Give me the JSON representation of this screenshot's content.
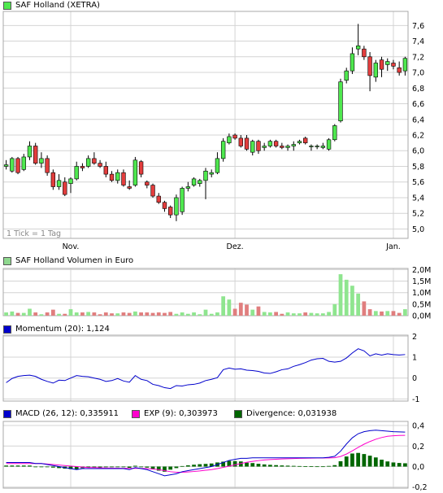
{
  "chart_data": [
    {
      "type": "candlestick",
      "title": "SAF Holland (XETRA)",
      "note": "1 Tick = 1 Tag",
      "colors": {
        "up": "#4fe84f",
        "down": "#e33d3d",
        "grid": "#d4d4d4",
        "wick": "#000000"
      },
      "x_labels": [
        {
          "label": "Nov.",
          "index": 11
        },
        {
          "label": "Dez.",
          "index": 39
        },
        {
          "label": "Jan.",
          "index": 66
        }
      ],
      "ylim": [
        4.88,
        7.78
      ],
      "y_ticks": [
        {
          "v": 5.0,
          "label": "5,0"
        },
        {
          "v": 5.2,
          "label": "5,2"
        },
        {
          "v": 5.4,
          "label": "5,4"
        },
        {
          "v": 5.6,
          "label": "5,6"
        },
        {
          "v": 5.8,
          "label": "5,8"
        },
        {
          "v": 6.0,
          "label": "6,0"
        },
        {
          "v": 6.2,
          "label": "6,2"
        },
        {
          "v": 6.4,
          "label": "6,4"
        },
        {
          "v": 6.6,
          "label": "6,6"
        },
        {
          "v": 6.8,
          "label": "6,8"
        },
        {
          "v": 7.0,
          "label": "7,0"
        },
        {
          "v": 7.2,
          "label": "7,2"
        },
        {
          "v": 7.4,
          "label": "7,4"
        },
        {
          "v": 7.6,
          "label": "7,6"
        }
      ],
      "ohlc": [
        [
          5.8,
          5.88,
          5.76,
          5.82
        ],
        [
          5.74,
          5.92,
          5.72,
          5.9
        ],
        [
          5.9,
          5.92,
          5.7,
          5.72
        ],
        [
          5.76,
          5.96,
          5.74,
          5.92
        ],
        [
          5.92,
          6.12,
          5.88,
          6.06
        ],
        [
          6.06,
          6.1,
          5.82,
          5.84
        ],
        [
          5.84,
          5.98,
          5.78,
          5.9
        ],
        [
          5.9,
          5.94,
          5.68,
          5.72
        ],
        [
          5.72,
          5.76,
          5.5,
          5.54
        ],
        [
          5.54,
          5.7,
          5.5,
          5.62
        ],
        [
          5.6,
          5.66,
          5.42,
          5.44
        ],
        [
          5.58,
          5.66,
          5.46,
          5.64
        ],
        [
          5.64,
          5.86,
          5.62,
          5.8
        ],
        [
          5.8,
          5.84,
          5.74,
          5.78
        ],
        [
          5.8,
          5.94,
          5.78,
          5.9
        ],
        [
          5.9,
          5.98,
          5.82,
          5.84
        ],
        [
          5.84,
          5.88,
          5.78,
          5.8
        ],
        [
          5.8,
          5.86,
          5.66,
          5.7
        ],
        [
          5.7,
          5.74,
          5.6,
          5.62
        ],
        [
          5.62,
          5.76,
          5.58,
          5.72
        ],
        [
          5.72,
          5.76,
          5.54,
          5.56
        ],
        [
          5.54,
          5.62,
          5.5,
          5.52
        ],
        [
          5.56,
          5.92,
          5.54,
          5.88
        ],
        [
          5.86,
          5.88,
          5.66,
          5.7
        ],
        [
          5.6,
          5.62,
          5.52,
          5.56
        ],
        [
          5.56,
          5.58,
          5.4,
          5.42
        ],
        [
          5.42,
          5.46,
          5.32,
          5.34
        ],
        [
          5.34,
          5.36,
          5.22,
          5.26
        ],
        [
          5.28,
          5.3,
          5.14,
          5.18
        ],
        [
          5.18,
          5.44,
          5.1,
          5.4
        ],
        [
          5.22,
          5.54,
          5.18,
          5.52
        ],
        [
          5.52,
          5.6,
          5.48,
          5.54
        ],
        [
          5.56,
          5.66,
          5.54,
          5.64
        ],
        [
          5.58,
          5.64,
          5.54,
          5.62
        ],
        [
          5.62,
          5.78,
          5.38,
          5.74
        ],
        [
          5.7,
          5.76,
          5.66,
          5.72
        ],
        [
          5.72,
          5.98,
          5.7,
          5.9
        ],
        [
          5.9,
          6.16,
          5.86,
          6.12
        ],
        [
          6.1,
          6.22,
          6.08,
          6.18
        ],
        [
          6.2,
          6.22,
          6.14,
          6.16
        ],
        [
          6.16,
          6.2,
          6.04,
          6.06
        ],
        [
          6.16,
          6.2,
          6.0,
          6.02
        ],
        [
          5.98,
          6.14,
          5.94,
          6.12
        ],
        [
          6.12,
          6.14,
          5.96,
          6.0
        ],
        [
          6.04,
          6.1,
          6.0,
          6.06
        ],
        [
          6.06,
          6.14,
          6.04,
          6.12
        ],
        [
          6.12,
          6.14,
          6.04,
          6.06
        ],
        [
          6.06,
          6.1,
          6.02,
          6.04
        ],
        [
          6.04,
          6.08,
          6.0,
          6.06
        ],
        [
          6.06,
          6.12,
          6.0,
          6.08
        ],
        [
          6.1,
          6.14,
          6.08,
          6.12
        ],
        [
          6.16,
          6.18,
          6.08,
          6.1
        ],
        [
          6.06,
          6.08,
          6.0,
          6.06
        ],
        [
          6.06,
          6.08,
          6.02,
          6.06
        ],
        [
          6.04,
          6.1,
          6.02,
          6.06
        ],
        [
          6.02,
          6.16,
          6.0,
          6.14
        ],
        [
          6.14,
          6.34,
          6.12,
          6.32
        ],
        [
          6.38,
          6.92,
          6.36,
          6.88
        ],
        [
          6.9,
          7.06,
          6.86,
          7.02
        ],
        [
          7.02,
          7.32,
          6.98,
          7.24
        ],
        [
          7.3,
          7.62,
          7.22,
          7.34
        ],
        [
          7.3,
          7.34,
          7.16,
          7.2
        ],
        [
          7.2,
          7.26,
          6.76,
          6.96
        ],
        [
          6.94,
          7.16,
          6.88,
          7.12
        ],
        [
          7.16,
          7.2,
          6.94,
          7.04
        ],
        [
          7.1,
          7.18,
          7.02,
          7.14
        ],
        [
          7.12,
          7.16,
          7.04,
          7.08
        ],
        [
          7.06,
          7.14,
          6.96,
          7.0
        ],
        [
          7.02,
          7.2,
          6.96,
          7.18
        ]
      ]
    },
    {
      "type": "bar",
      "title": "SAF Holland Volumen in Euro",
      "ylim": [
        0,
        2.05
      ],
      "y_ticks": [
        {
          "v": 0,
          "label": "0,0M"
        },
        {
          "v": 0.5,
          "label": "0,5M"
        },
        {
          "v": 1.0,
          "label": "1,0M"
        },
        {
          "v": 1.5,
          "label": "1,5M"
        },
        {
          "v": 2.0,
          "label": "2,0M"
        }
      ],
      "values": [
        0.14,
        0.18,
        0.12,
        0.12,
        0.3,
        0.14,
        0.06,
        0.14,
        0.26,
        0.08,
        0.08,
        0.28,
        0.14,
        0.14,
        0.16,
        0.14,
        0.06,
        0.14,
        0.1,
        0.1,
        0.14,
        0.12,
        0.18,
        0.14,
        0.14,
        0.12,
        0.14,
        0.12,
        0.16,
        0.08,
        0.14,
        0.08,
        0.14,
        0.06,
        0.26,
        0.08,
        0.14,
        0.84,
        0.7,
        0.3,
        0.56,
        0.48,
        0.26,
        0.4,
        0.16,
        0.14,
        0.16,
        0.08,
        0.14,
        0.1,
        0.1,
        0.14,
        0.12,
        0.1,
        0.1,
        0.16,
        0.5,
        1.8,
        1.56,
        1.3,
        0.96,
        0.62,
        0.28,
        0.2,
        0.18,
        0.2,
        0.2,
        0.12,
        0.28
      ]
    },
    {
      "type": "line",
      "title": "Momentum (20)",
      "value_label": "1,124",
      "color": "#0000cc",
      "ylim": [
        -1.1,
        2.05
      ],
      "y_ticks": [
        {
          "v": -1,
          "label": "-1"
        },
        {
          "v": 0,
          "label": "0"
        },
        {
          "v": 1,
          "label": "1"
        },
        {
          "v": 2,
          "label": "2"
        }
      ],
      "values": [
        -0.22,
        -0.02,
        0.08,
        0.12,
        0.14,
        0.08,
        -0.06,
        -0.16,
        -0.24,
        -0.1,
        -0.12,
        0.0,
        0.12,
        0.08,
        0.06,
        0.0,
        -0.06,
        -0.16,
        -0.12,
        -0.02,
        -0.14,
        -0.2,
        0.12,
        -0.06,
        -0.12,
        -0.3,
        -0.36,
        -0.46,
        -0.5,
        -0.36,
        -0.38,
        -0.32,
        -0.3,
        -0.24,
        -0.12,
        -0.06,
        0.02,
        0.4,
        0.48,
        0.42,
        0.44,
        0.38,
        0.36,
        0.32,
        0.24,
        0.22,
        0.3,
        0.4,
        0.44,
        0.56,
        0.64,
        0.74,
        0.86,
        0.92,
        0.94,
        0.8,
        0.76,
        0.8,
        0.96,
        1.2,
        1.4,
        1.3,
        1.06,
        1.16,
        1.1,
        1.16,
        1.12,
        1.1,
        1.124
      ]
    },
    {
      "type": "line",
      "title": "MACD",
      "ylim": [
        -0.21,
        0.44
      ],
      "y_ticks": [
        {
          "v": -0.2,
          "label": "-0,2"
        },
        {
          "v": 0,
          "label": "0,0"
        },
        {
          "v": 0.2,
          "label": "0,2"
        },
        {
          "v": 0.4,
          "label": "0,4"
        }
      ],
      "series": [
        {
          "name": "MACD (26, 12)",
          "value_label": "0,335911",
          "color": "#0000cc",
          "values": [
            0.04,
            0.04,
            0.04,
            0.04,
            0.04,
            0.03,
            0.03,
            0.02,
            0.01,
            0.0,
            -0.01,
            -0.02,
            -0.03,
            -0.02,
            -0.02,
            -0.02,
            -0.02,
            -0.02,
            -0.02,
            -0.02,
            -0.02,
            -0.03,
            -0.01,
            -0.02,
            -0.03,
            -0.05,
            -0.07,
            -0.09,
            -0.08,
            -0.07,
            -0.05,
            -0.04,
            -0.03,
            -0.02,
            -0.01,
            0.0,
            0.02,
            0.04,
            0.06,
            0.07,
            0.08,
            0.08,
            0.085,
            0.085,
            0.085,
            0.085,
            0.085,
            0.085,
            0.085,
            0.085,
            0.085,
            0.085,
            0.085,
            0.085,
            0.085,
            0.09,
            0.1,
            0.15,
            0.22,
            0.28,
            0.32,
            0.34,
            0.35,
            0.355,
            0.35,
            0.345,
            0.34,
            0.338,
            0.336
          ]
        },
        {
          "name": "EXP (9)",
          "value_label": "0,303973",
          "color": "#ff00cc",
          "values": [
            0.03,
            0.03,
            0.03,
            0.03,
            0.03,
            0.03,
            0.03,
            0.025,
            0.02,
            0.015,
            0.01,
            0.005,
            0.0,
            -0.005,
            -0.01,
            -0.01,
            -0.012,
            -0.014,
            -0.015,
            -0.016,
            -0.017,
            -0.018,
            -0.018,
            -0.018,
            -0.02,
            -0.025,
            -0.03,
            -0.04,
            -0.05,
            -0.055,
            -0.055,
            -0.052,
            -0.048,
            -0.043,
            -0.036,
            -0.03,
            -0.02,
            -0.008,
            0.004,
            0.017,
            0.03,
            0.042,
            0.051,
            0.058,
            0.064,
            0.068,
            0.071,
            0.074,
            0.076,
            0.078,
            0.08,
            0.081,
            0.082,
            0.083,
            0.083,
            0.084,
            0.086,
            0.098,
            0.122,
            0.153,
            0.187,
            0.218,
            0.244,
            0.266,
            0.283,
            0.295,
            0.3,
            0.303,
            0.304
          ]
        },
        {
          "name": "Divergence",
          "value_label": "0,031938",
          "color": "#006600",
          "kind": "bar",
          "values": [
            0.01,
            0.01,
            0.01,
            0.01,
            0.01,
            0.0,
            0.0,
            -0.005,
            -0.01,
            -0.015,
            -0.02,
            -0.025,
            -0.03,
            -0.015,
            -0.01,
            -0.01,
            -0.008,
            -0.006,
            -0.005,
            -0.004,
            -0.003,
            -0.012,
            0.008,
            -0.002,
            -0.01,
            -0.025,
            -0.04,
            -0.05,
            -0.03,
            -0.015,
            0.005,
            0.012,
            0.018,
            0.023,
            0.026,
            0.03,
            0.04,
            0.048,
            0.056,
            0.053,
            0.05,
            0.038,
            0.034,
            0.027,
            0.021,
            0.017,
            0.014,
            0.011,
            0.009,
            0.007,
            0.005,
            0.004,
            0.003,
            0.002,
            0.002,
            0.006,
            0.014,
            0.052,
            0.098,
            0.127,
            0.133,
            0.122,
            0.106,
            0.089,
            0.067,
            0.05,
            0.04,
            0.035,
            0.032
          ]
        }
      ]
    }
  ]
}
